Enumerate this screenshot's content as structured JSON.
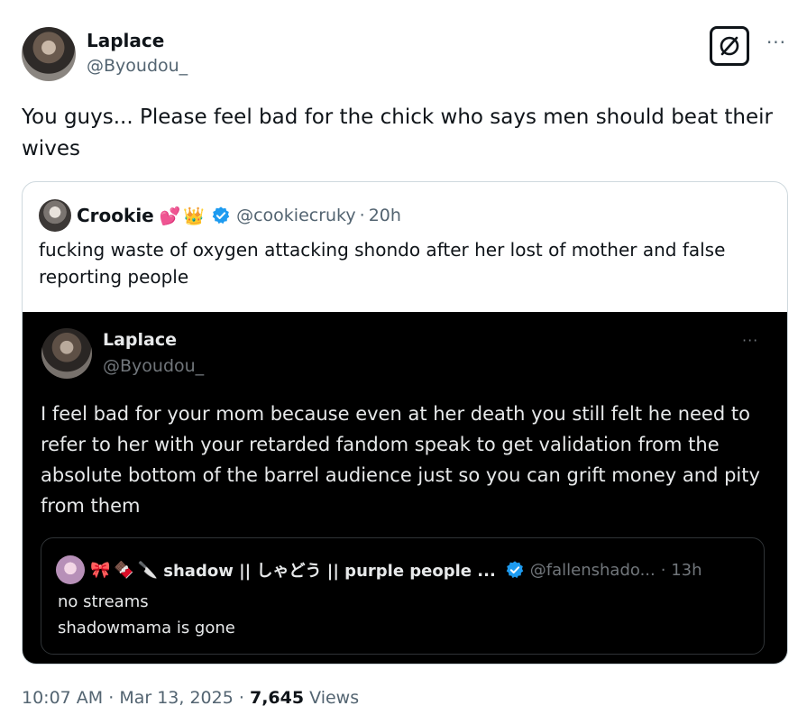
{
  "post": {
    "author": {
      "name": "Laplace",
      "handle": "@Byoudou_"
    },
    "text": "You guys... Please feel bad for the chick who says men should beat their wives",
    "more_label": "···",
    "time": "10:07 AM",
    "date": "Mar 13, 2025",
    "separator": "·",
    "views_count": "7,645",
    "views_label": "Views"
  },
  "quote": {
    "author": {
      "name": "Crookie",
      "emojis": [
        "💕",
        "👑"
      ],
      "handle": "@cookiecruky",
      "time": "20h",
      "verified": true
    },
    "text": "fucking waste of oxygen attacking shondo after her lost of mother and false reporting people",
    "separator": "·",
    "image": {
      "author": {
        "name": "Laplace",
        "handle": "@Byoudou_"
      },
      "more_label": "···",
      "text": "I feel bad for your mom because even at her death you still felt he need to refer to her with your retarded fandom speak to get validation from the absolute bottom of the barrel audience just so you can grift money and pity from them",
      "nested_quote": {
        "emojis": [
          "🎀",
          "🍫",
          "🔪"
        ],
        "name": "shadow || しゃどう || purple people ...",
        "handle": "@fallenshado...",
        "time": "· 13h",
        "verified": true,
        "text": "no streams\nshadowmama is gone"
      }
    }
  },
  "colors": {
    "text_primary": "#0f1419",
    "text_secondary": "#536471",
    "verified_blue": "#1d9bf0",
    "border": "#cfd9de",
    "dark_bg": "#000000",
    "dark_text": "#e7e9ea",
    "dark_secondary": "#71767b"
  },
  "icons": {
    "grok": "grok-icon",
    "more": "more-icon",
    "verified": "verified-badge-icon"
  }
}
